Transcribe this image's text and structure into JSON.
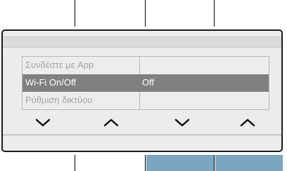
{
  "menu": {
    "items": [
      {
        "label": "Συνδέστε με App",
        "value": ""
      },
      {
        "label": "Wi-Fi On/Off",
        "value": "Off",
        "selected": true
      },
      {
        "label": "Ρύθμιση δικτύου",
        "value": ""
      }
    ]
  },
  "softkeys": [
    {
      "icon": "chevron-down-icon"
    },
    {
      "icon": "chevron-up-icon"
    },
    {
      "icon": "chevron-down-icon"
    },
    {
      "icon": "chevron-up-icon"
    }
  ],
  "colors": {
    "selected_row": "#808080",
    "screen_bg": "#ececec",
    "softkey_active": "#7aa6c2"
  }
}
